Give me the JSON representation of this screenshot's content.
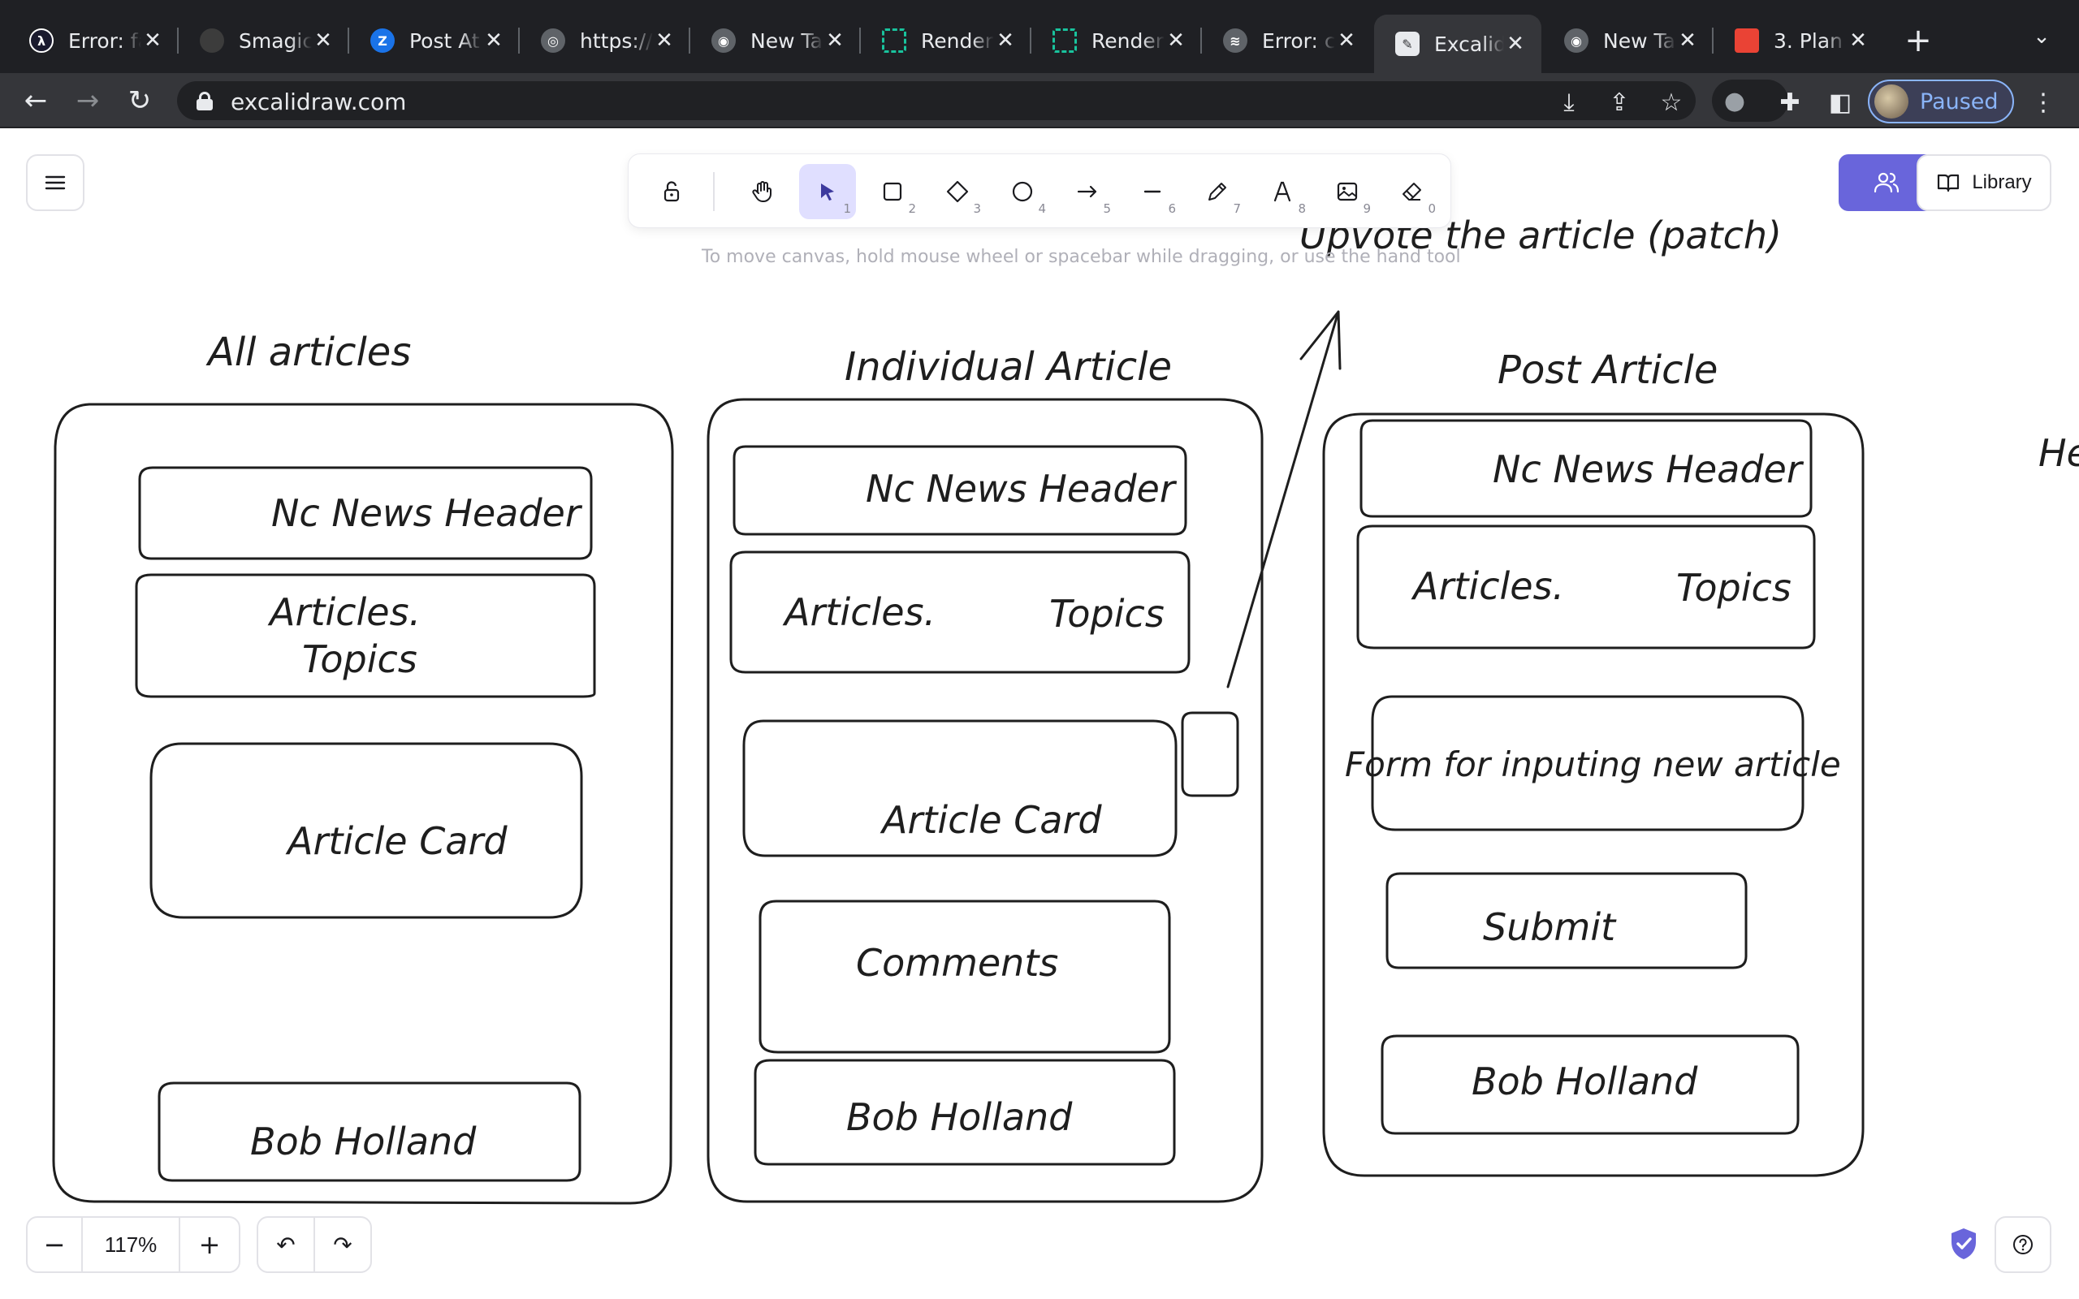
{
  "browser": {
    "tabs": [
      {
        "title": "Error: fa",
        "icon": "error-icon",
        "color": "#1a1a2e"
      },
      {
        "title": "Smagic",
        "icon": "github-icon",
        "color": "#3c3c3c"
      },
      {
        "title": "Post At",
        "icon": "zeta-icon",
        "color": "#1a73e8"
      },
      {
        "title": "https://",
        "icon": "globe-icon",
        "color": "#5f6368"
      },
      {
        "title": "New Ta",
        "icon": "chrome-icon",
        "color": "#5f6368"
      },
      {
        "title": "Render",
        "icon": "render-icon",
        "color": "#19c39d"
      },
      {
        "title": "Render",
        "icon": "render-icon",
        "color": "#19c39d"
      },
      {
        "title": "Error: c",
        "icon": "docker-icon",
        "color": "#5f6368"
      },
      {
        "title": "Excalid",
        "icon": "excalidraw-icon",
        "color": "#e8eaed"
      },
      {
        "title": "New Ta",
        "icon": "chrome-icon",
        "color": "#5f6368"
      },
      {
        "title": "3. Plan",
        "icon": "pdf-icon",
        "color": "#ea4335"
      }
    ],
    "active_tab_index": 8,
    "url": "excalidraw.com",
    "profile_status": "Paused"
  },
  "excalidraw": {
    "zoom": "117%",
    "hint": "To move canvas, hold mouse wheel or spacebar while dragging, or use the hand tool",
    "library_label": "Library",
    "tools": [
      {
        "name": "lock",
        "key": ""
      },
      {
        "name": "hand",
        "key": ""
      },
      {
        "name": "selection",
        "key": "1"
      },
      {
        "name": "rectangle",
        "key": "2"
      },
      {
        "name": "diamond",
        "key": "3"
      },
      {
        "name": "ellipse",
        "key": "4"
      },
      {
        "name": "arrow",
        "key": "5"
      },
      {
        "name": "line",
        "key": "6"
      },
      {
        "name": "draw",
        "key": "7"
      },
      {
        "name": "text",
        "key": "8"
      },
      {
        "name": "image",
        "key": "9"
      },
      {
        "name": "eraser",
        "key": "0"
      }
    ],
    "active_tool": "selection",
    "colors": {
      "accent": "#6965db",
      "accent_light": "#e0dfff",
      "stroke": "#1e1e1e"
    }
  },
  "canvas": {
    "upvote_label": "Upvote the article (patch)",
    "edge_text": "He",
    "frames": [
      {
        "title": "All articles",
        "boxes": [
          "Nc News Header",
          "Articles.",
          "Topics",
          "Article Card",
          "Bob Holland"
        ]
      },
      {
        "title": "Individual Article",
        "boxes": [
          "Nc News Header",
          "Articles.",
          "Topics",
          "Article Card",
          "Comments",
          "Bob Holland"
        ]
      },
      {
        "title": "Post Article",
        "boxes": [
          "Nc News Header",
          "Articles.",
          "Topics",
          "Form for inputing new article",
          "Submit",
          "Bob Holland"
        ]
      }
    ]
  }
}
